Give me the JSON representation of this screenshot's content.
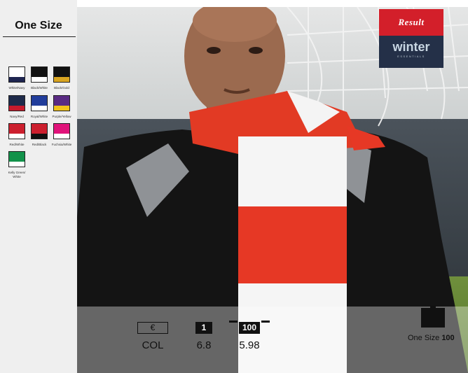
{
  "size_title": "One Size",
  "swatches": [
    {
      "label": "White/Navy",
      "main": "#ffffff",
      "trim": "#1e2550"
    },
    {
      "label": "Black/White",
      "main": "#111111",
      "trim": "#ffffff"
    },
    {
      "label": "Black/Gold",
      "main": "#111111",
      "trim": "#d9a521"
    },
    {
      "label": "Navy/Red",
      "main": "#1e2a4a",
      "trim": "#c81a2c"
    },
    {
      "label": "Royal/White",
      "main": "#213d9b",
      "trim": "#ffffff"
    },
    {
      "label": "Purple/Yellow",
      "main": "#5a2a83",
      "trim": "#f2c21a"
    },
    {
      "label": "Red/White",
      "main": "#cc1f2e",
      "trim": "#ffffff"
    },
    {
      "label": "Red/Black",
      "main": "#cc1f2e",
      "trim": "#111111"
    },
    {
      "label": "Fuchsia/White",
      "main": "#e0137a",
      "trim": "#ffffff"
    },
    {
      "label": "Kelly Green/ White",
      "main": "#12924a",
      "trim": "#ffffff"
    }
  ],
  "brand": {
    "top": "Result",
    "name": "winter",
    "tagline": "ESSENTIALS"
  },
  "pricing": {
    "currency_symbol": "€",
    "currency_label": "COL",
    "qty1": "1",
    "qty2": "100",
    "price1": "6.8",
    "price2": "5.98"
  },
  "pack": {
    "size": "One Size",
    "quantity": "100"
  },
  "colors": {
    "sidebar_bg": "#efefef",
    "brand_red": "#d31f2a",
    "brand_navy": "#243048"
  }
}
